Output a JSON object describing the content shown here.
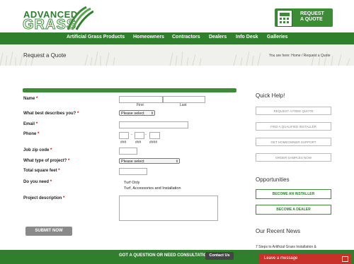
{
  "header": {
    "logo_top": "ADVANCED",
    "logo_bottom": "GRASS",
    "quote_line1": "REQUEST",
    "quote_line2": "A QUOTE"
  },
  "nav": {
    "items": [
      "Artificial Grass Products",
      "Homeowners",
      "Contractors",
      "Dealers",
      "Info Desk",
      "Galleries"
    ]
  },
  "page": {
    "title": "Request a Quote",
    "breadcrumb": "You are here: Home / Request a Quote"
  },
  "form": {
    "name_label": "Name",
    "first_label": "First",
    "last_label": "Last",
    "describe_label": "What best describes you?",
    "describe_value": "Please select",
    "email_label": "Email",
    "phone_label": "Phone",
    "phone_sep": "-",
    "phone_hint1": "###",
    "phone_hint2": "###",
    "phone_hint3": "####",
    "zip_label": "Job zip code",
    "project_type_label": "What type of project?",
    "project_type_value": "Please select",
    "sqft_label": "Total square feet",
    "need_label": "Do you need",
    "need_options": [
      "Turf Only",
      "Turf, Accessories and Installation"
    ],
    "desc_label": "Project description",
    "submit": "SUBMIT NOW",
    "required_mark": "*"
  },
  "sidebar": {
    "quick_help": "Quick Help!",
    "help_buttons": [
      "REQUEST A FREE QUOTE",
      "FIND A QUALIFIED INSTALLER",
      "GET HOMEOWNER SUPPORT",
      "ORDER SAMPLES NOW"
    ],
    "opportunities": "Opportunities",
    "opp_buttons": [
      "BECOME AN INSTALLER",
      "BECOME A DEALER"
    ],
    "news_head": "Our Recent News",
    "news_item": "7 Steps to Artificial Grass Installation &"
  },
  "footer": {
    "question": "GOT A QUESTION OR NEED CONSULTATION?",
    "contact": "Contact Us",
    "leave_message": "Leave a message"
  },
  "colors": {
    "brand_green": "#2f7f2c",
    "required_red": "#cc0000",
    "leave_message_red": "#c8302a"
  }
}
